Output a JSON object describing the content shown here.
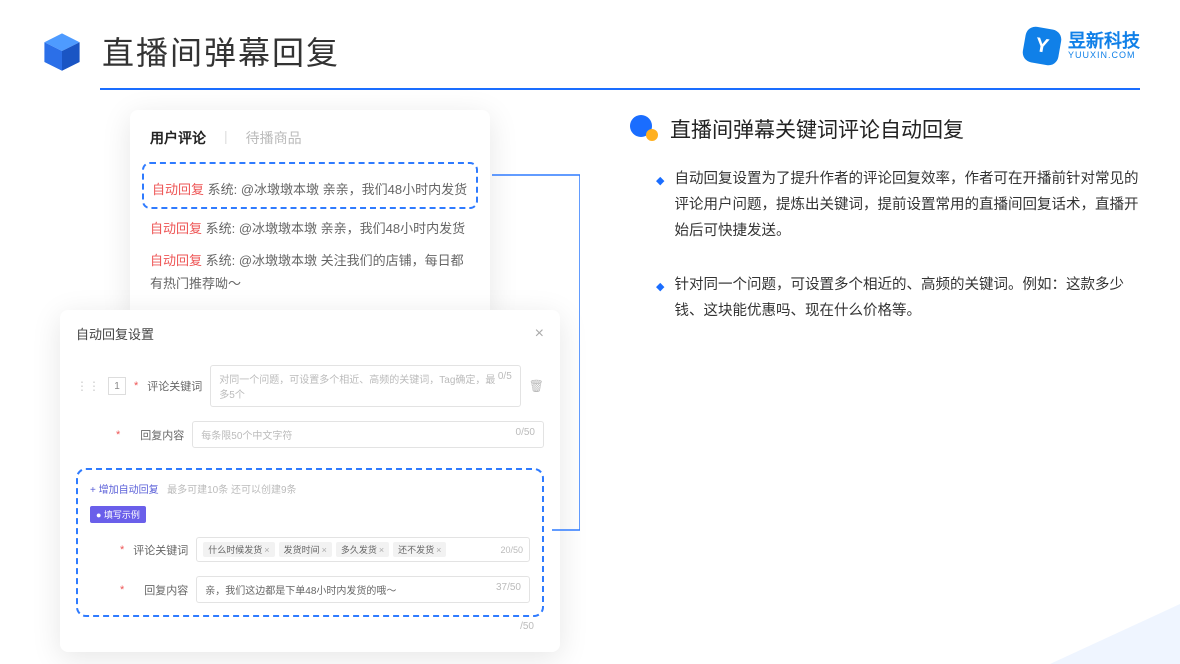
{
  "header": {
    "title": "直播间弹幕回复"
  },
  "logo": {
    "name": "昱新科技",
    "sub": "YUUXIN.COM",
    "mark": "Y"
  },
  "cardA": {
    "tabActive": "用户评论",
    "tabInactive": "待播商品",
    "msg1_tag": "自动回复",
    "msg1": " 系统: @冰墩墩本墩 亲亲，我们48小时内发货",
    "msg2_tag": "自动回复",
    "msg2": " 系统: @冰墩墩本墩 亲亲，我们48小时内发货",
    "msg3_tag": "自动回复",
    "msg3": " 系统: @冰墩墩本墩 关注我们的店铺，每日都有热门推荐呦～"
  },
  "cardB": {
    "title": "自动回复设置",
    "idx": "1",
    "kw_label": "评论关键词",
    "kw_placeholder": "对同一个问题，可设置多个相近、高频的关键词，Tag确定，最多5个",
    "kw_count": "0/5",
    "content_label": "回复内容",
    "content_placeholder": "每条限50个中文字符",
    "content_count": "0/50",
    "add_link": "+ 增加自动回复",
    "add_hint": "最多可建10条 还可以创建9条",
    "example_badge": "● 填写示例",
    "ex_kw_label": "评论关键词",
    "ex_tags": [
      "什么时候发货",
      "发货时间",
      "多久发货",
      "还不发货"
    ],
    "ex_kw_count": "20/50",
    "ex_content_label": "回复内容",
    "ex_content_value": "亲，我们这边都是下单48小时内发货的哦～",
    "ex_content_count": "37/50",
    "tail_count": "/50"
  },
  "right": {
    "title": "直播间弹幕关键词评论自动回复",
    "b1": "自动回复设置为了提升作者的评论回复效率，作者可在开播前针对常见的评论用户问题，提炼出关键词，提前设置常用的直播间回复话术，直播开始后可快捷发送。",
    "b2": "针对同一个问题，可设置多个相近的、高频的关键词。例如：这款多少钱、这块能优惠吗、现在什么价格等。"
  }
}
